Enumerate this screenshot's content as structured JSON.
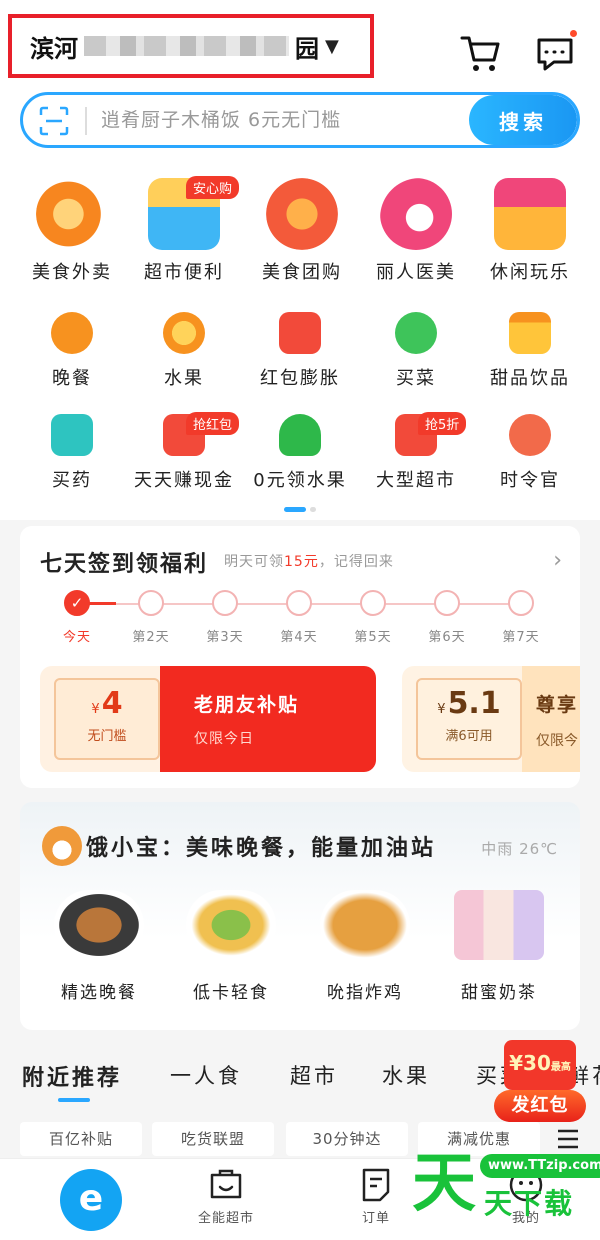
{
  "header": {
    "location_prefix": "滨河",
    "location_suffix": "园",
    "icons": {
      "cart": "cart-icon",
      "messages": "message-icon"
    }
  },
  "search": {
    "placeholder": "逍肴厨子木桶饭 6元无门槛",
    "button_label": "搜索"
  },
  "categories": {
    "row1": [
      {
        "label": "美食外卖",
        "icon": "food-delivery-icon"
      },
      {
        "label": "超市便利",
        "icon": "basket-icon",
        "tag": "安心购"
      },
      {
        "label": "美食团购",
        "icon": "fork-plate-icon"
      },
      {
        "label": "丽人医美",
        "icon": "beauty-icon"
      },
      {
        "label": "休闲玩乐",
        "icon": "gift-icon"
      }
    ],
    "row2": [
      {
        "label": "晚餐",
        "icon": "chicken-icon"
      },
      {
        "label": "水果",
        "icon": "orange-icon"
      },
      {
        "label": "红包膨胀",
        "icon": "red-packet-icon"
      },
      {
        "label": "买菜",
        "icon": "broccoli-icon"
      },
      {
        "label": "甜品饮品",
        "icon": "drink-cup-icon"
      }
    ],
    "row3": [
      {
        "label": "买药",
        "icon": "medicine-kit-icon"
      },
      {
        "label": "天天赚现金",
        "icon": "cash-envelope-icon",
        "tag": "抢红包"
      },
      {
        "label": "0元领水果",
        "icon": "tree-icon"
      },
      {
        "label": "大型超市",
        "icon": "shopping-cart-icon",
        "tag": "抢5折"
      },
      {
        "label": "时令官",
        "icon": "bowl-icon"
      }
    ]
  },
  "signin": {
    "title": "七天签到领福利",
    "subtitle_pre": "明天可领",
    "subtitle_amount": "15元",
    "subtitle_post": "，记得回来",
    "days": [
      "今天",
      "第2天",
      "第3天",
      "第4天",
      "第5天",
      "第6天",
      "第7天"
    ],
    "completed_days": 1,
    "coupons": [
      {
        "amount": "4",
        "currency": "¥",
        "condition": "无门槛",
        "title": "老朋友补贴",
        "desc": "仅限今日"
      },
      {
        "amount": "5.1",
        "currency": "¥",
        "condition": "满6可用",
        "title": "尊享",
        "desc": "仅限今"
      }
    ]
  },
  "ebao": {
    "title": "饿小宝：美味晚餐，能量加油站",
    "weather": "中雨 26℃",
    "items": [
      {
        "label": "精选晚餐"
      },
      {
        "label": "低卡轻食"
      },
      {
        "label": "吮指炸鸡"
      },
      {
        "label": "甜蜜奶茶"
      }
    ]
  },
  "tabs": [
    "附近推荐",
    "一人食",
    "超市",
    "水果",
    "买菜",
    "鲜花"
  ],
  "filters": [
    "百亿补贴",
    "吃货联盟",
    "30分钟达",
    "满减优惠"
  ],
  "redpack": {
    "amount": "¥30",
    "note": "最高",
    "button": "发红包"
  },
  "bottom_nav": [
    {
      "label": ""
    },
    {
      "label": "全能超市"
    },
    {
      "label": "订单"
    },
    {
      "label": ""
    },
    {
      "label": "我的"
    }
  ],
  "watermark": {
    "big": "天",
    "url": "www.TTzip.com",
    "small": "天下载"
  },
  "colors": {
    "accent": "#2aa7ff",
    "red": "#f23a2a",
    "watermark": "#19c23a"
  }
}
